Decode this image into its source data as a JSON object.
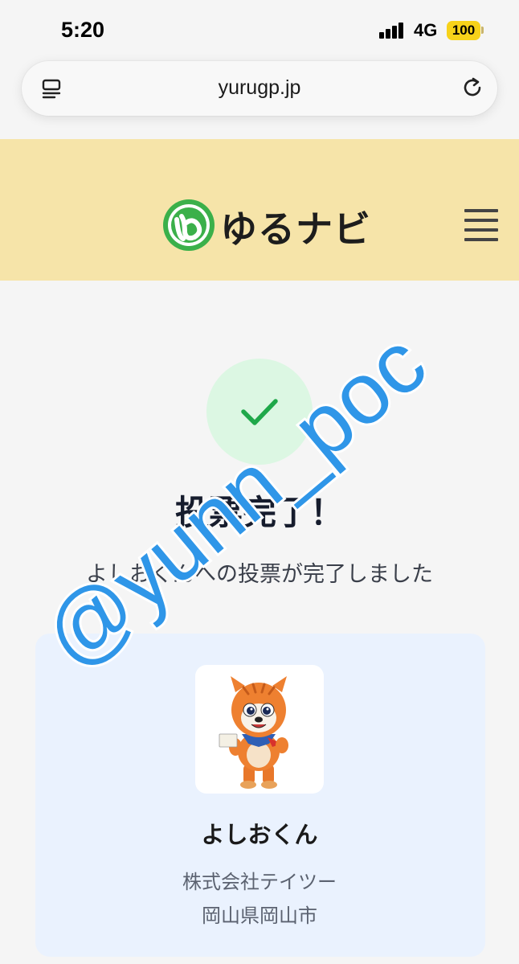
{
  "status_bar": {
    "time": "5:20",
    "network": "4G",
    "battery": "100"
  },
  "browser": {
    "url": "yurugp.jp"
  },
  "site": {
    "logo_text": "ゆるナビ",
    "brand_color": "#f6e4a9",
    "logo_green": "#3bb04a"
  },
  "result": {
    "title": "投票完了！",
    "message": "よしおくんへの投票が完了しました",
    "success_color": "#1fa84a"
  },
  "mascot": {
    "name": "よしおくん",
    "company": "株式会社テイツー",
    "location": "岡山県岡山市"
  },
  "watermark": "@yunn_poc"
}
